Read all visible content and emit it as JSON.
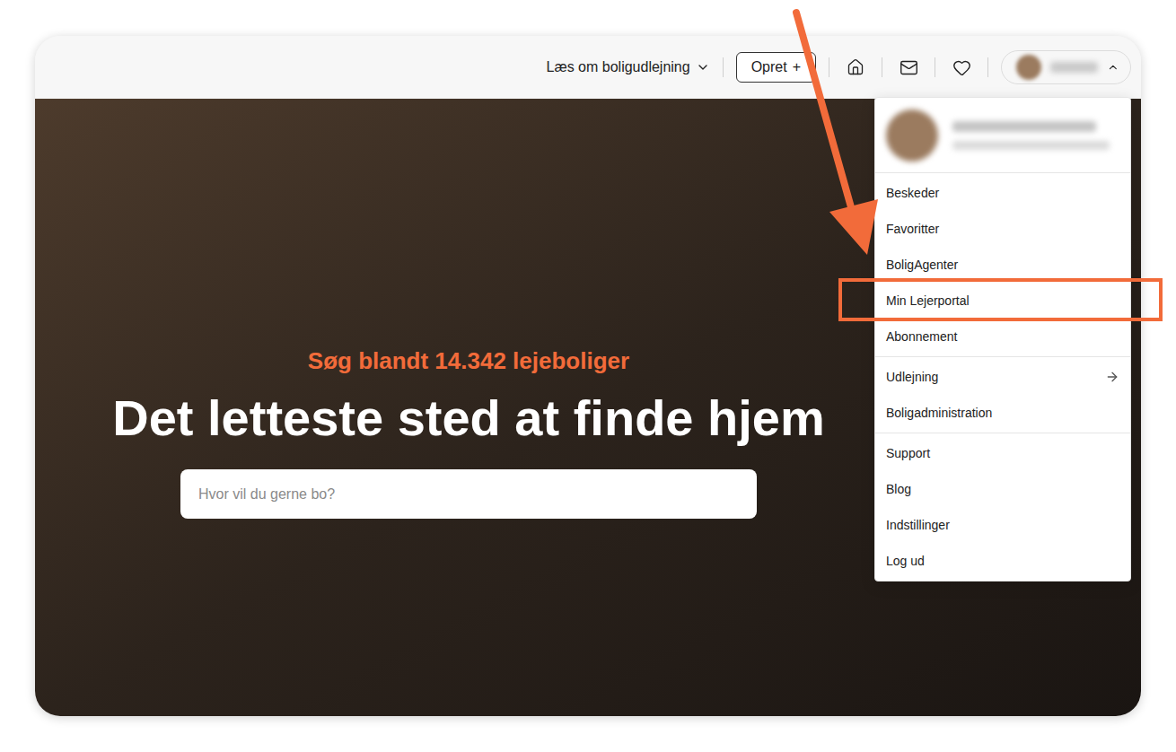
{
  "header": {
    "read_about": {
      "label": "Læs om boligudlejning",
      "expanded": false
    },
    "create_button": {
      "label": "Opret",
      "symbol": "+"
    },
    "account": {
      "expanded": true,
      "blurred": true
    }
  },
  "hero": {
    "eyebrow": "Søg blandt 14.342 lejeboliger",
    "title": "Det letteste sted at finde hjem",
    "search": {
      "placeholder": "Hvor vil du gerne bo?"
    }
  },
  "menu": {
    "profile": {
      "blurred": true
    },
    "groups": [
      [
        {
          "label": "Beskeder",
          "arrow": false,
          "highlighted": false
        },
        {
          "label": "Favoritter",
          "arrow": false,
          "highlighted": false
        },
        {
          "label": "BoligAgenter",
          "arrow": false,
          "highlighted": false
        },
        {
          "label": "Min Lejerportal",
          "arrow": false,
          "highlighted": true
        },
        {
          "label": "Abonnement",
          "arrow": false,
          "highlighted": false
        }
      ],
      [
        {
          "label": "Udlejning",
          "arrow": true,
          "highlighted": false
        },
        {
          "label": "Boligadministration",
          "arrow": false,
          "highlighted": false
        }
      ],
      [
        {
          "label": "Support",
          "arrow": false,
          "highlighted": false
        },
        {
          "label": "Blog",
          "arrow": false,
          "highlighted": false
        },
        {
          "label": "Indstillinger",
          "arrow": false,
          "highlighted": false
        },
        {
          "label": "Log ud",
          "arrow": false,
          "highlighted": false
        }
      ]
    ]
  },
  "annotation": {
    "arrow": true
  }
}
